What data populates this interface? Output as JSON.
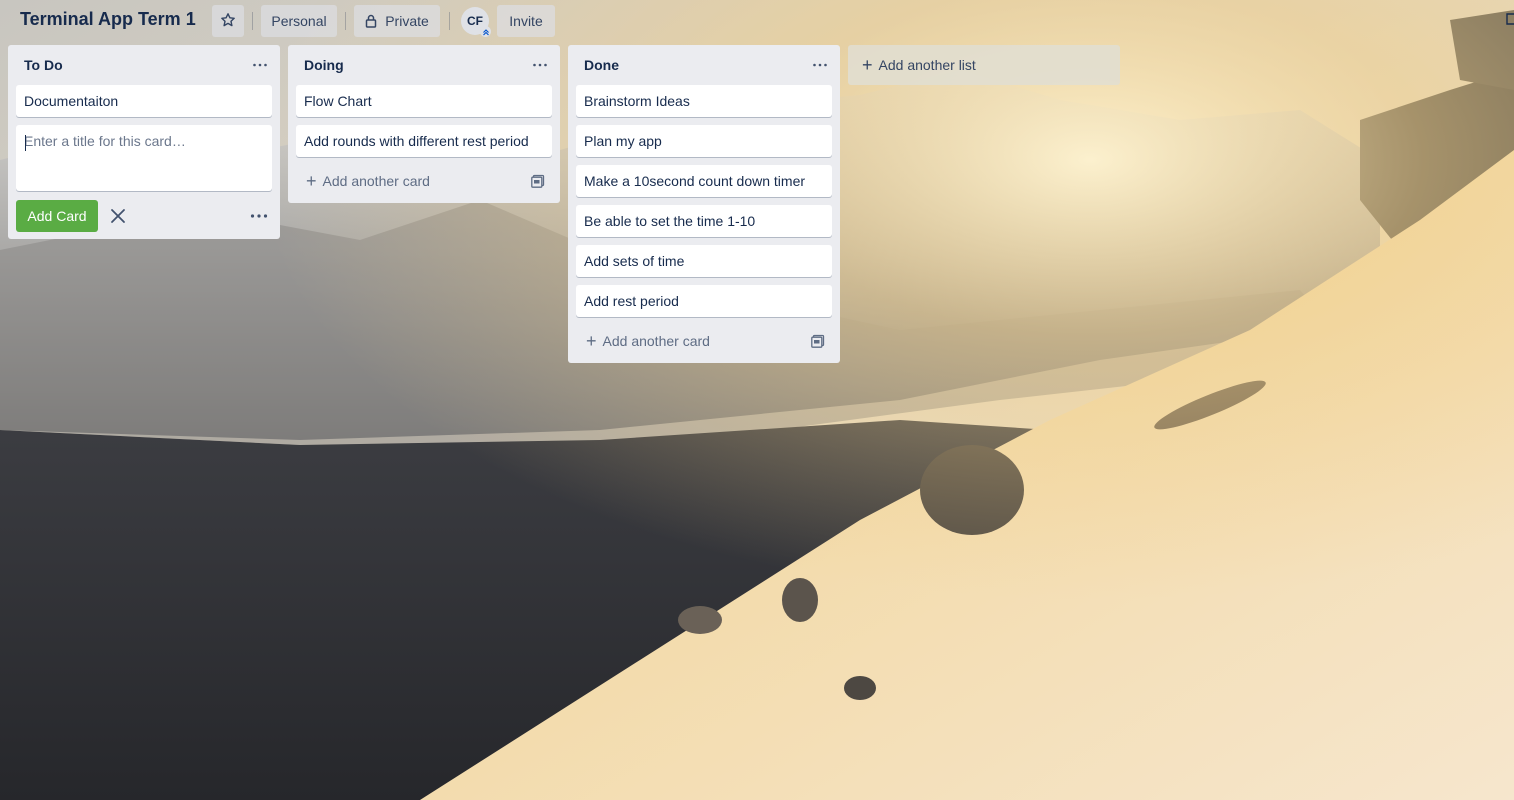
{
  "board": {
    "title": "Terminal App Term 1",
    "visibility_label": "Personal",
    "privacy_label": "Private",
    "member_initials": "CF",
    "invite_label": "Invite"
  },
  "icons": {
    "star": "star-icon",
    "lock": "lock-icon",
    "more": "more-horizontal-icon",
    "plus": "plus-icon",
    "close": "close-icon",
    "template": "card-template-icon"
  },
  "lists": [
    {
      "title": "To Do",
      "cards": [
        "Documentaiton"
      ],
      "composer": {
        "placeholder": "Enter a title for this card…",
        "value": "",
        "add_button_label": "Add Card"
      }
    },
    {
      "title": "Doing",
      "cards": [
        "Flow Chart",
        "Add rounds with different rest period"
      ],
      "add_card_label": "Add another card"
    },
    {
      "title": "Done",
      "cards": [
        "Brainstorm Ideas",
        "Plan my app",
        "Make a 10second count down timer",
        "Be able to set the time 1-10",
        "Add sets of time",
        "Add rest period"
      ],
      "add_card_label": "Add another card"
    }
  ],
  "add_list_label": "Add another list",
  "colors": {
    "list_background": "#ebecf0",
    "card_background": "#ffffff",
    "add_card_button": "#5aac44",
    "title_text": "#172b4d"
  }
}
